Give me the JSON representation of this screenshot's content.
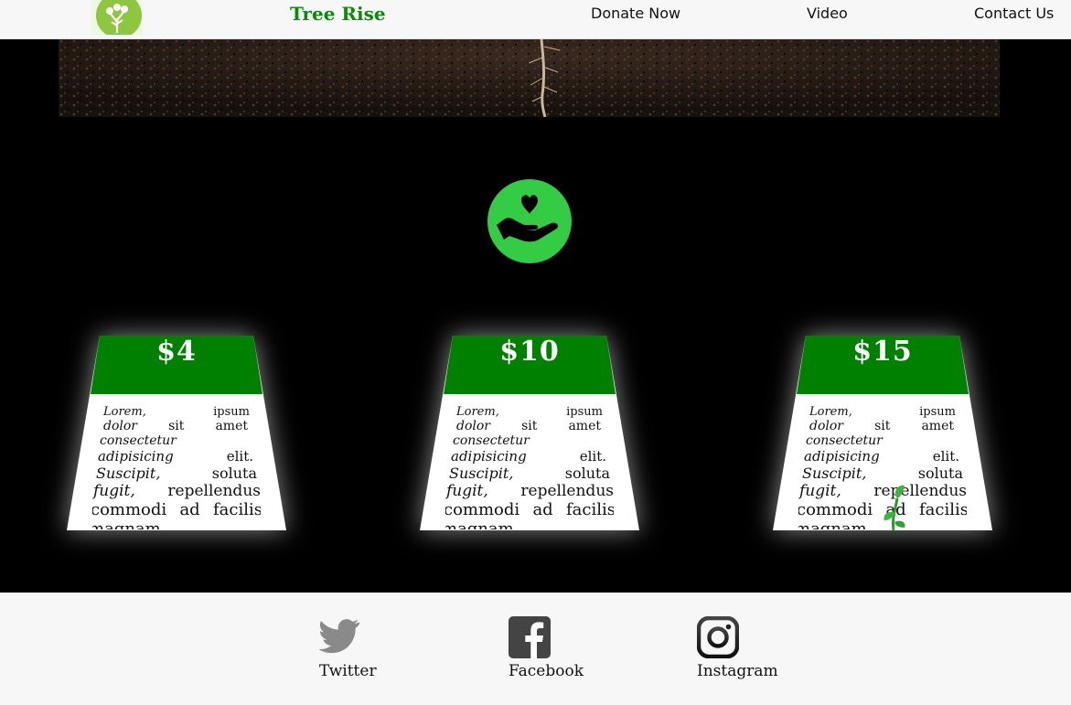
{
  "brand": {
    "name": "Tree Rise",
    "logo_icon": "tree-logo-icon",
    "accent": "#0a8a0a"
  },
  "nav": {
    "links": [
      {
        "label": "Donate Now"
      },
      {
        "label": "Video"
      },
      {
        "label": "Contact Us"
      }
    ]
  },
  "hero": {
    "image": "soil-with-seedling-roots"
  },
  "donate": {
    "icon": "hand-heart-icon",
    "color": "#33cc44"
  },
  "cards": [
    {
      "price": "$4",
      "lines": [
        "Lorem,|ipsum",
        "dolor|sit|amet",
        "consectetur",
        "adipisicing|elit.",
        "Suscipit,|soluta",
        "fugit,|repellendus",
        "commodi|ad|facilis",
        "magnam"
      ]
    },
    {
      "price": "$10",
      "lines": [
        "Lorem,|ipsum",
        "dolor|sit|amet",
        "consectetur",
        "adipisicing|elit.",
        "Suscipit,|soluta",
        "fugit,|repellendus",
        "commodi|ad|facilis",
        "magnam"
      ]
    },
    {
      "price": "$15",
      "lines": [
        "Lorem,|ipsum",
        "dolor|sit|amet",
        "consectetur",
        "adipisicing|elit.",
        "Suscipit,|soluta",
        "fugit,|repellendus",
        "commodi|ad|facilis",
        "magnam"
      ]
    }
  ],
  "card_colors": {
    "header": "#008000",
    "body": "#ffffff"
  },
  "footer": {
    "social": [
      {
        "label": "Twitter",
        "icon": "twitter-icon"
      },
      {
        "label": "Facebook",
        "icon": "facebook-icon"
      },
      {
        "label": "Instagram",
        "icon": "instagram-icon"
      }
    ]
  }
}
